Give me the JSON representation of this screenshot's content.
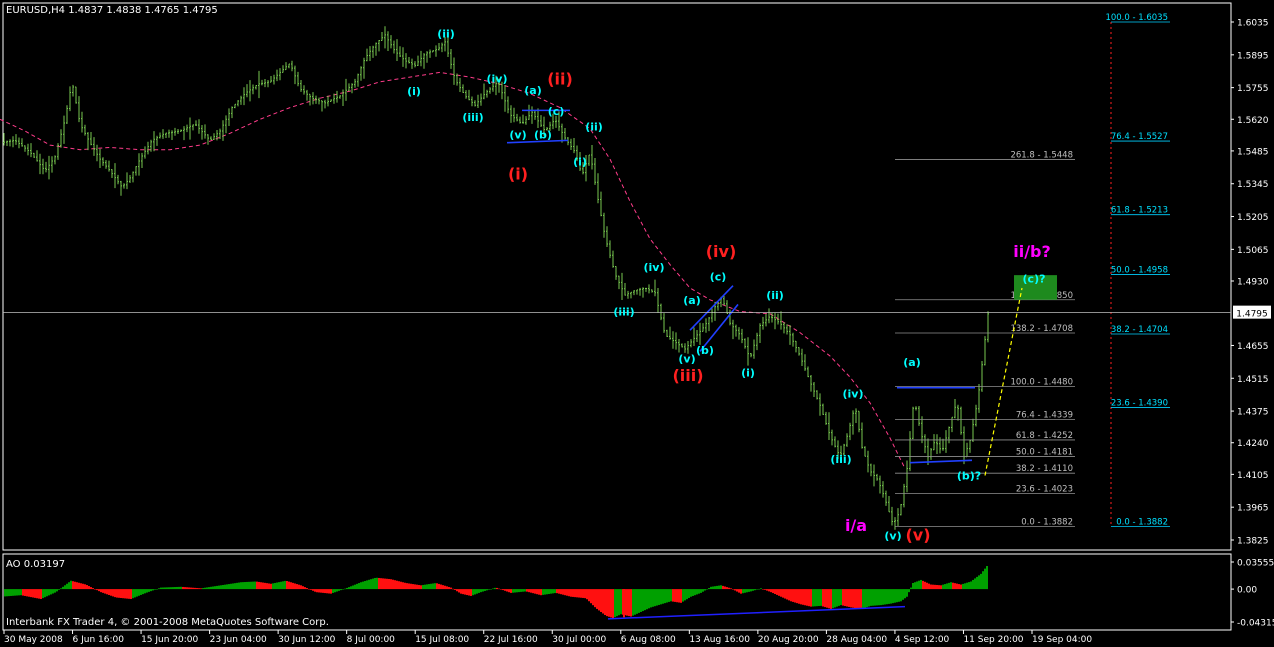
{
  "window": {
    "symbol_header": "EURUSD,H4  1.4837 1.4838 1.4765 1.4795",
    "copyright": "Interbank FX Trader 4, © 2001-2008 MetaQuotes Software Corp."
  },
  "chart_data": {
    "type": "candlestick",
    "symbol": "EURUSD",
    "timeframe": "H4",
    "ohlc_last": {
      "open": 1.4837,
      "high": 1.4838,
      "low": 1.4765,
      "close": 1.4795
    },
    "current_price_label": "1.4795",
    "ylim": [
      1.3825,
      1.6035
    ],
    "y_ticks": [
      "1.6035",
      "1.5895",
      "1.5755",
      "1.5620",
      "1.5485",
      "1.5345",
      "1.5205",
      "1.5065",
      "1.4930",
      "1.4795",
      "1.4655",
      "1.4515",
      "1.4375",
      "1.4240",
      "1.4105",
      "1.3965",
      "1.3825"
    ],
    "x_ticks": [
      "30 May 2008",
      "6 Jun 16:00",
      "15 Jun 20:00",
      "23 Jun 04:00",
      "30 Jun 12:00",
      "8 Jul 00:00",
      "15 Jul 08:00",
      "22 Jul 16:00",
      "30 Jul 00:00",
      "6 Aug 08:00",
      "13 Aug 16:00",
      "20 Aug 20:00",
      "28 Aug 04:00",
      "4 Sep 12:00",
      "11 Sep 20:00",
      "19 Sep 04:00"
    ],
    "price_path": [
      [
        0,
        1.552
      ],
      [
        15,
        1.553
      ],
      [
        30,
        1.548
      ],
      [
        45,
        1.54
      ],
      [
        55,
        1.546
      ],
      [
        65,
        1.562
      ],
      [
        72,
        1.578
      ],
      [
        80,
        1.56
      ],
      [
        90,
        1.552
      ],
      [
        100,
        1.545
      ],
      [
        110,
        1.54
      ],
      [
        122,
        1.533
      ],
      [
        130,
        1.537
      ],
      [
        140,
        1.545
      ],
      [
        152,
        1.553
      ],
      [
        165,
        1.556
      ],
      [
        180,
        1.557
      ],
      [
        195,
        1.56
      ],
      [
        210,
        1.553
      ],
      [
        220,
        1.557
      ],
      [
        232,
        1.567
      ],
      [
        245,
        1.573
      ],
      [
        258,
        1.577
      ],
      [
        270,
        1.578
      ],
      [
        280,
        1.582
      ],
      [
        290,
        1.586
      ],
      [
        300,
        1.575
      ],
      [
        312,
        1.571
      ],
      [
        325,
        1.569
      ],
      [
        340,
        1.572
      ],
      [
        355,
        1.578
      ],
      [
        365,
        1.588
      ],
      [
        375,
        1.594
      ],
      [
        385,
        1.598
      ],
      [
        395,
        1.591
      ],
      [
        405,
        1.587
      ],
      [
        415,
        1.585
      ],
      [
        425,
        1.59
      ],
      [
        438,
        1.592
      ],
      [
        445,
        1.595
      ],
      [
        455,
        1.579
      ],
      [
        465,
        1.572
      ],
      [
        475,
        1.568
      ],
      [
        485,
        1.573
      ],
      [
        498,
        1.578
      ],
      [
        510,
        1.564
      ],
      [
        522,
        1.56
      ],
      [
        532,
        1.565
      ],
      [
        545,
        1.557
      ],
      [
        555,
        1.562
      ],
      [
        565,
        1.554
      ],
      [
        575,
        1.548
      ],
      [
        582,
        1.538
      ],
      [
        590,
        1.548
      ],
      [
        597,
        1.53
      ],
      [
        605,
        1.512
      ],
      [
        615,
        1.496
      ],
      [
        625,
        1.487
      ],
      [
        635,
        1.489
      ],
      [
        645,
        1.49
      ],
      [
        655,
        1.488
      ],
      [
        665,
        1.47
      ],
      [
        675,
        1.467
      ],
      [
        685,
        1.464
      ],
      [
        695,
        1.469
      ],
      [
        705,
        1.474
      ],
      [
        715,
        1.482
      ],
      [
        722,
        1.486
      ],
      [
        730,
        1.475
      ],
      [
        740,
        1.47
      ],
      [
        750,
        1.46
      ],
      [
        760,
        1.474
      ],
      [
        770,
        1.478
      ],
      [
        780,
        1.475
      ],
      [
        790,
        1.47
      ],
      [
        800,
        1.461
      ],
      [
        810,
        1.45
      ],
      [
        820,
        1.44
      ],
      [
        830,
        1.427
      ],
      [
        840,
        1.418
      ],
      [
        848,
        1.428
      ],
      [
        855,
        1.44
      ],
      [
        862,
        1.422
      ],
      [
        870,
        1.412
      ],
      [
        878,
        1.408
      ],
      [
        885,
        1.4
      ],
      [
        893,
        1.389
      ],
      [
        900,
        1.395
      ],
      [
        907,
        1.413
      ],
      [
        914,
        1.443
      ],
      [
        921,
        1.428
      ],
      [
        928,
        1.418
      ],
      [
        935,
        1.425
      ],
      [
        942,
        1.42
      ],
      [
        950,
        1.432
      ],
      [
        957,
        1.442
      ],
      [
        964,
        1.418
      ],
      [
        970,
        1.425
      ],
      [
        978,
        1.443
      ],
      [
        985,
        1.468
      ],
      [
        988,
        1.479
      ]
    ],
    "ma_path": [
      [
        0,
        1.562
      ],
      [
        25,
        1.557
      ],
      [
        50,
        1.551
      ],
      [
        80,
        1.549
      ],
      [
        110,
        1.55
      ],
      [
        140,
        1.549
      ],
      [
        170,
        1.549
      ],
      [
        200,
        1.551
      ],
      [
        230,
        1.556
      ],
      [
        260,
        1.562
      ],
      [
        290,
        1.567
      ],
      [
        320,
        1.571
      ],
      [
        350,
        1.574
      ],
      [
        380,
        1.578
      ],
      [
        410,
        1.58
      ],
      [
        440,
        1.582
      ],
      [
        470,
        1.58
      ],
      [
        500,
        1.577
      ],
      [
        530,
        1.573
      ],
      [
        560,
        1.567
      ],
      [
        590,
        1.558
      ],
      [
        610,
        1.545
      ],
      [
        630,
        1.527
      ],
      [
        650,
        1.511
      ],
      [
        670,
        1.5
      ],
      [
        690,
        1.49
      ],
      [
        710,
        1.485
      ],
      [
        740,
        1.48
      ],
      [
        770,
        1.479
      ],
      [
        800,
        1.471
      ],
      [
        830,
        1.461
      ],
      [
        850,
        1.452
      ],
      [
        870,
        1.441
      ],
      [
        890,
        1.426
      ],
      [
        905,
        1.413
      ]
    ],
    "ao_indicator": {
      "label": "AO 0.03197",
      "ylim": [
        -0.04315,
        0.03555
      ],
      "y_ticks": [
        "0.03555",
        "0.00",
        "-0.04315"
      ],
      "path": [
        [
          0,
          -0.01
        ],
        [
          20,
          -0.008
        ],
        [
          40,
          -0.013
        ],
        [
          55,
          -0.004
        ],
        [
          70,
          0.011
        ],
        [
          85,
          0.006
        ],
        [
          100,
          -0.004
        ],
        [
          115,
          -0.011
        ],
        [
          130,
          -0.013
        ],
        [
          145,
          -0.005
        ],
        [
          160,
          0.002
        ],
        [
          180,
          0.003
        ],
        [
          200,
          0.001
        ],
        [
          220,
          0.005
        ],
        [
          240,
          0.009
        ],
        [
          255,
          0.01
        ],
        [
          270,
          0.007
        ],
        [
          285,
          0.011
        ],
        [
          300,
          0.005
        ],
        [
          315,
          -0.004
        ],
        [
          330,
          -0.006
        ],
        [
          345,
          0.001
        ],
        [
          360,
          0.009
        ],
        [
          375,
          0.015
        ],
        [
          390,
          0.013
        ],
        [
          405,
          0.008
        ],
        [
          420,
          0.005
        ],
        [
          435,
          0.008
        ],
        [
          450,
          0.002
        ],
        [
          460,
          -0.006
        ],
        [
          470,
          -0.009
        ],
        [
          480,
          -0.004
        ],
        [
          495,
          0.002
        ],
        [
          510,
          -0.005
        ],
        [
          525,
          -0.003
        ],
        [
          540,
          -0.008
        ],
        [
          555,
          -0.005
        ],
        [
          570,
          -0.01
        ],
        [
          585,
          -0.012
        ],
        [
          595,
          -0.025
        ],
        [
          605,
          -0.035
        ],
        [
          612,
          -0.038
        ],
        [
          620,
          -0.033
        ],
        [
          630,
          -0.036
        ],
        [
          640,
          -0.03
        ],
        [
          650,
          -0.024
        ],
        [
          660,
          -0.02
        ],
        [
          670,
          -0.016
        ],
        [
          680,
          -0.018
        ],
        [
          690,
          -0.01
        ],
        [
          700,
          -0.005
        ],
        [
          710,
          0.003
        ],
        [
          720,
          0.005
        ],
        [
          730,
          0.001
        ],
        [
          740,
          -0.006
        ],
        [
          750,
          -0.003
        ],
        [
          760,
          0.001
        ],
        [
          770,
          -0.004
        ],
        [
          780,
          -0.01
        ],
        [
          790,
          -0.016
        ],
        [
          800,
          -0.02
        ],
        [
          810,
          -0.023
        ],
        [
          820,
          -0.022
        ],
        [
          830,
          -0.026
        ],
        [
          840,
          -0.021
        ],
        [
          850,
          -0.024
        ],
        [
          860,
          -0.026
        ],
        [
          870,
          -0.022
        ],
        [
          880,
          -0.021
        ],
        [
          890,
          -0.019
        ],
        [
          900,
          -0.016
        ],
        [
          906,
          -0.01
        ],
        [
          912,
          0.008
        ],
        [
          920,
          0.012
        ],
        [
          930,
          0.006
        ],
        [
          940,
          0.005
        ],
        [
          950,
          0.009
        ],
        [
          960,
          0.006
        ],
        [
          970,
          0.01
        ],
        [
          980,
          0.02
        ],
        [
          987,
          0.032
        ]
      ]
    },
    "fibonacci_left": [
      {
        "label": "261.8 - 1.5448",
        "price": 1.5448
      },
      {
        "label": "161.8 - 1.4850",
        "price": 1.485
      },
      {
        "label": "138.2 - 1.4708",
        "price": 1.4708
      },
      {
        "label": "100.0 - 1.4480",
        "price": 1.448
      },
      {
        "label": "76.4 - 1.4339",
        "price": 1.4339
      },
      {
        "label": "61.8 - 1.4252",
        "price": 1.4252
      },
      {
        "label": "50.0 - 1.4181",
        "price": 1.4181
      },
      {
        "label": "38.2 - 1.4110",
        "price": 1.411
      },
      {
        "label": "23.6 - 1.4023",
        "price": 1.4023
      },
      {
        "label": "0.0 - 1.3882",
        "price": 1.3882
      }
    ],
    "fibonacci_right": [
      {
        "label": "100.0 - 1.6035",
        "price": 1.6035
      },
      {
        "label": "76.4 - 1.5527",
        "price": 1.5527
      },
      {
        "label": "61.8 - 1.5213",
        "price": 1.5213
      },
      {
        "label": "50.0 - 1.4958",
        "price": 1.4958
      },
      {
        "label": "38.2 - 1.4704",
        "price": 1.4704
      },
      {
        "label": "23.6 - 1.4390",
        "price": 1.439
      },
      {
        "label": "0.0 - 1.3882",
        "price": 1.3882
      }
    ],
    "wave_labels": [
      {
        "text": "(ii)",
        "x": 446,
        "price": 1.5985,
        "color": "#00ffff"
      },
      {
        "text": "(i)",
        "x": 414,
        "price": 1.574,
        "color": "#00ffff"
      },
      {
        "text": "(iv)",
        "x": 497,
        "price": 1.5795,
        "color": "#00ffff"
      },
      {
        "text": "(iii)",
        "x": 473,
        "price": 1.563,
        "color": "#00ffff"
      },
      {
        "text": "(a)",
        "x": 533,
        "price": 1.5745,
        "color": "#00ffff"
      },
      {
        "text": "(c)",
        "x": 556,
        "price": 1.5655,
        "color": "#00ffff"
      },
      {
        "text": "(v)",
        "x": 518,
        "price": 1.5555,
        "color": "#00ffff"
      },
      {
        "text": "(b)",
        "x": 543,
        "price": 1.5555,
        "color": "#00ffff"
      },
      {
        "text": "(ii)",
        "x": 594,
        "price": 1.559,
        "color": "#00ffff"
      },
      {
        "text": "(i)",
        "x": 580,
        "price": 1.544,
        "color": "#00ffff"
      },
      {
        "text": "(iv)",
        "x": 654,
        "price": 1.499,
        "color": "#00ffff"
      },
      {
        "text": "(iii)",
        "x": 624,
        "price": 1.48,
        "color": "#00ffff"
      },
      {
        "text": "(c)",
        "x": 718,
        "price": 1.495,
        "color": "#00ffff"
      },
      {
        "text": "(a)",
        "x": 692,
        "price": 1.485,
        "color": "#00ffff"
      },
      {
        "text": "(b)",
        "x": 705,
        "price": 1.4635,
        "color": "#00ffff"
      },
      {
        "text": "(v)",
        "x": 687,
        "price": 1.46,
        "color": "#00ffff"
      },
      {
        "text": "(ii)",
        "x": 775,
        "price": 1.487,
        "color": "#00ffff"
      },
      {
        "text": "(i)",
        "x": 748,
        "price": 1.454,
        "color": "#00ffff"
      },
      {
        "text": "(iv)",
        "x": 853,
        "price": 1.445,
        "color": "#00ffff"
      },
      {
        "text": "(iii)",
        "x": 841,
        "price": 1.417,
        "color": "#00ffff"
      },
      {
        "text": "(a)",
        "x": 912,
        "price": 1.4585,
        "color": "#00ffff"
      },
      {
        "text": "(b)?",
        "x": 969,
        "price": 1.41,
        "color": "#00ffff"
      },
      {
        "text": "(v)",
        "x": 893,
        "price": 1.3845,
        "color": "#00ffff"
      },
      {
        "text": "(c)?",
        "x": 1034,
        "price": 1.494,
        "color": "#00ffff"
      },
      {
        "text": "(ii)",
        "x": 560,
        "price": 1.5785,
        "color": "#ff2020"
      },
      {
        "text": "(i)",
        "x": 518,
        "price": 1.538,
        "color": "#ff2020"
      },
      {
        "text": "(iv)",
        "x": 721,
        "price": 1.505,
        "color": "#ff2020"
      },
      {
        "text": "(iii)",
        "x": 688,
        "price": 1.452,
        "color": "#ff2020"
      },
      {
        "text": "(v)",
        "x": 918,
        "price": 1.384,
        "color": "#ff2020"
      },
      {
        "text": "i/a",
        "x": 856,
        "price": 1.388,
        "color": "#ff00ff"
      },
      {
        "text": "ii/b?",
        "x": 1032,
        "price": 1.505,
        "color": "#ff00ff"
      }
    ]
  }
}
